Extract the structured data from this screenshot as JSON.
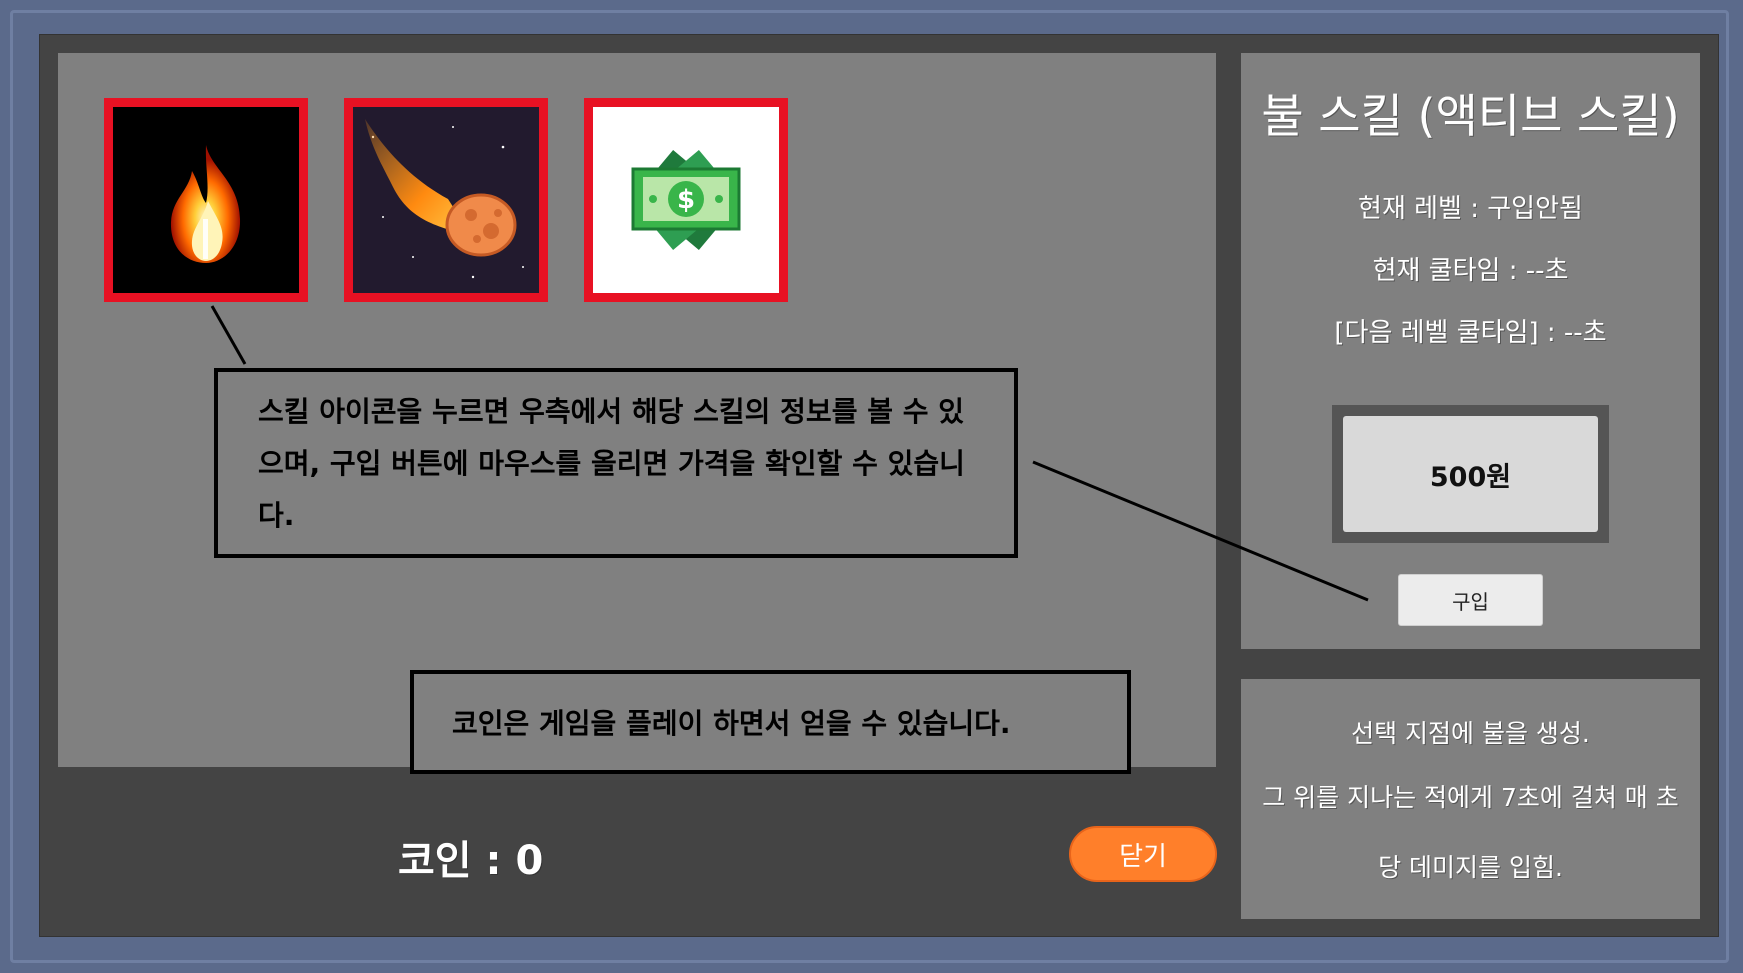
{
  "skills": [
    {
      "name": "fire-skill",
      "icon": "fire-icon"
    },
    {
      "name": "meteor-skill",
      "icon": "meteor-icon"
    },
    {
      "name": "money-skill",
      "icon": "money-icon"
    }
  ],
  "info": {
    "title": "불 스킬 (액티브 스킬)",
    "current_level": "현재 레벨 : 구입안됨",
    "current_cooldown": "현재 쿨타임 : --초",
    "next_cooldown": "[다음 레벨 쿨타임] : --초",
    "price": "500원",
    "buy_label": "구입"
  },
  "description": {
    "line1": "선택 지점에 불을 생성.",
    "line2": "그 위를 지나는 적에게 7초에 걸쳐 매 초",
    "line3": "당 데미지를 입힘."
  },
  "footer": {
    "coin_text": "코인 : 0",
    "close_label": "닫기"
  },
  "callouts": {
    "skill_info": "스킬 아이콘을 누르면 우측에서 해당 스킬의 정보를 볼 수 있으며, 구입 버튼에 마우스를 올리면 가격을 확인할 수 있습니다.",
    "coin_info": "코인은 게임을 플레이 하면서 얻을 수 있습니다."
  },
  "colors": {
    "icon_border": "#e81123",
    "close_button": "#ff7f2a",
    "panel": "#808080",
    "window": "#444444",
    "frame": "#5b6a8b"
  }
}
